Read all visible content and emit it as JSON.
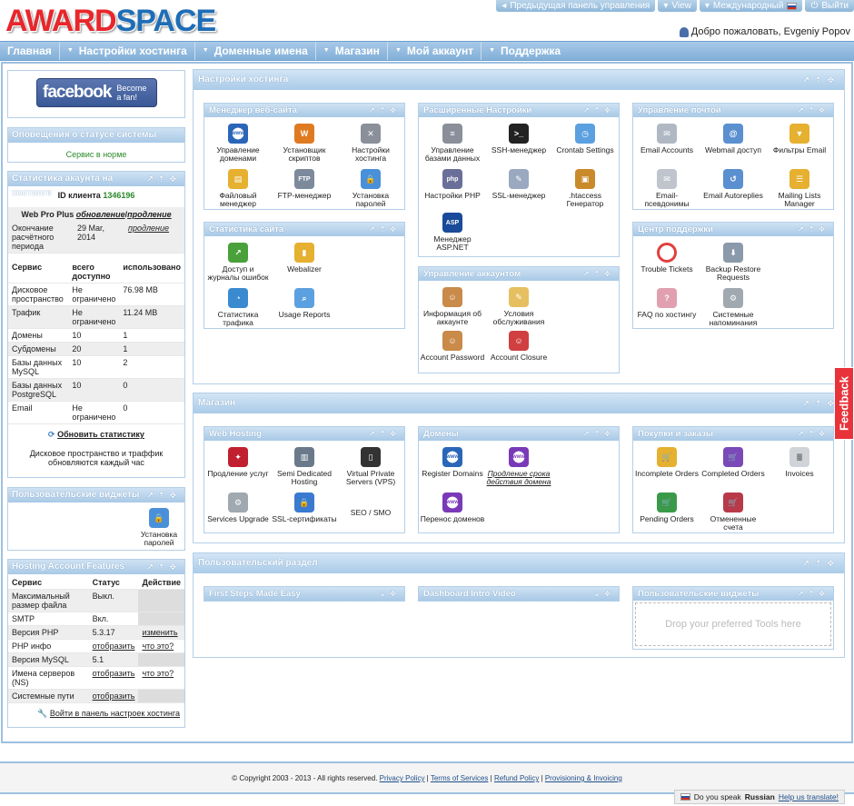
{
  "logo": {
    "part1": "AWARD",
    "part2": "SPACE"
  },
  "topbar": {
    "prev": "Предыдущая панель управления",
    "view": "View",
    "intl": "Международный",
    "logout": "Выйти"
  },
  "welcome": "Добро пожаловать, Evgeniy Popov",
  "nav": [
    "Главная",
    "Настройки хостинга",
    "Доменные имена",
    "Магазин",
    "Мой аккаунт",
    "Поддержка"
  ],
  "facebook": {
    "name": "facebook",
    "line1": "Become",
    "line2": "a fan!"
  },
  "alerts": {
    "title": "Оповещения о статусе системы",
    "status": "Сервис в норме"
  },
  "stats": {
    "title": "Статистика акаунта на хостинге",
    "client_label": "ID клиента",
    "client_id": "1346196",
    "plan": "Web Pro Plus",
    "renew": "обновление",
    "extend": "продление",
    "period_label": "Окончание расчётного периода",
    "period_date": "29 Мar, 2014",
    "period_link": "продление",
    "headers": [
      "Сервис",
      "всего доступно",
      "использовано"
    ],
    "rows": [
      [
        "Дисковое пространство",
        "Не ограничено",
        "76.98 MB"
      ],
      [
        "Трафик",
        "Не ограничено",
        "11.24 MB"
      ],
      [
        "Домены",
        "10",
        "1"
      ],
      [
        "Субдомены",
        "20",
        "1"
      ],
      [
        "Базы данных MySQL",
        "10",
        "2"
      ],
      [
        "Базы данных PostgreSQL",
        "10",
        "0"
      ],
      [
        "Email",
        "Не ограничено",
        "0"
      ]
    ],
    "refresh": "Обновить статистику",
    "note": "Дисковое пространство и траффик обновляются каждый час"
  },
  "widgets": {
    "title": "Пользовательские виджеты",
    "item": "Установка паролей"
  },
  "features": {
    "title": "Hosting Account Features",
    "headers": [
      "Сервис",
      "Статус",
      "Действие"
    ],
    "rows": [
      [
        "Максимальный размер файла",
        "Выкл.",
        ""
      ],
      [
        "SMTP",
        "Вкл.",
        ""
      ],
      [
        "Версия PHP",
        "5.3.17",
        "изменить"
      ],
      [
        "PHP инфо",
        "отобразить",
        "что это?"
      ],
      [
        "Версия MySQL",
        "5.1",
        ""
      ],
      [
        "Имена серверов (NS)",
        "отобразить",
        "что это?"
      ],
      [
        "Системные пути",
        "отобразить",
        ""
      ]
    ],
    "link": "Войти в панель настроек хостинга"
  },
  "hosting": {
    "title": "Настройки хостинга",
    "site_manager": {
      "title": "Менеджер веб-сайта",
      "items": [
        "Управление доменами",
        "Установщик скриптов",
        "Настройки хостинга",
        "Файловый менеджер",
        "FTP-менеджер",
        "Установка паролей"
      ]
    },
    "advanced": {
      "title": "Расширенные Настройки",
      "items": [
        "Управление базами данных",
        "SSH-менеджер",
        "Crontab Settings",
        "Настройки PHP",
        "SSL-менеджер",
        ".htaccess Генератор",
        "Менеджер ASP.NET"
      ]
    },
    "mail": {
      "title": "Управление почтой",
      "items": [
        "Email Accounts",
        "Webmail доступ",
        "Фильтры Email",
        "Email-псевдонимы",
        "Email Autoreplies",
        "Mailing Lists Manager"
      ]
    },
    "site_stats": {
      "title": "Статистика сайта",
      "items": [
        "Доступ и журналы ошибок",
        "Webalizer",
        "Статистика трафика",
        "Usage Reports"
      ]
    },
    "account": {
      "title": "Управление аккаунтом",
      "items": [
        "Информация об аккаунте",
        "Условия обслуживания",
        "Account Password",
        "Account Closure"
      ]
    },
    "support": {
      "title": "Центр поддержки",
      "items": [
        "Trouble Tickets",
        "Backup Restore Requests",
        "FAQ по хостингу",
        "Системные напоминания"
      ]
    }
  },
  "shop": {
    "title": "Магазин",
    "web": {
      "title": "Web Hosting",
      "items": [
        "Продление услуг",
        "Semi Dedicated Hosting",
        "Virtual Private Servers (VPS)",
        "Services Upgrade",
        "SSL-сертификаты",
        "SEO / SMO"
      ]
    },
    "domains": {
      "title": "Домены",
      "items": [
        "Register Domains",
        "Продление срока действия домена",
        "Перенос доменов"
      ]
    },
    "orders": {
      "title": "Покупки и заказы",
      "items": [
        "Incomplete Orders",
        "Completed Orders",
        "Invoices",
        "Pending Orders",
        "Отмененные счета"
      ]
    }
  },
  "user": {
    "title": "Пользовательский раздел",
    "first": "First Steps Made Easy",
    "intro": "Dashboard Intro Video",
    "widgets": "Пользовательские виджеты",
    "drop": "Drop your preferred Tools here"
  },
  "footer": {
    "copy": "© Copyright 2003 - 2013 - All rights reserved.",
    "links": [
      "Privacy Policy",
      "Terms of Services",
      "Refund Policy",
      "Provisioning & Invoicing"
    ]
  },
  "speak": {
    "q": "Do you speak",
    "lang": "Russian",
    "help": "Help us translate!"
  },
  "feedback": "Feedback"
}
